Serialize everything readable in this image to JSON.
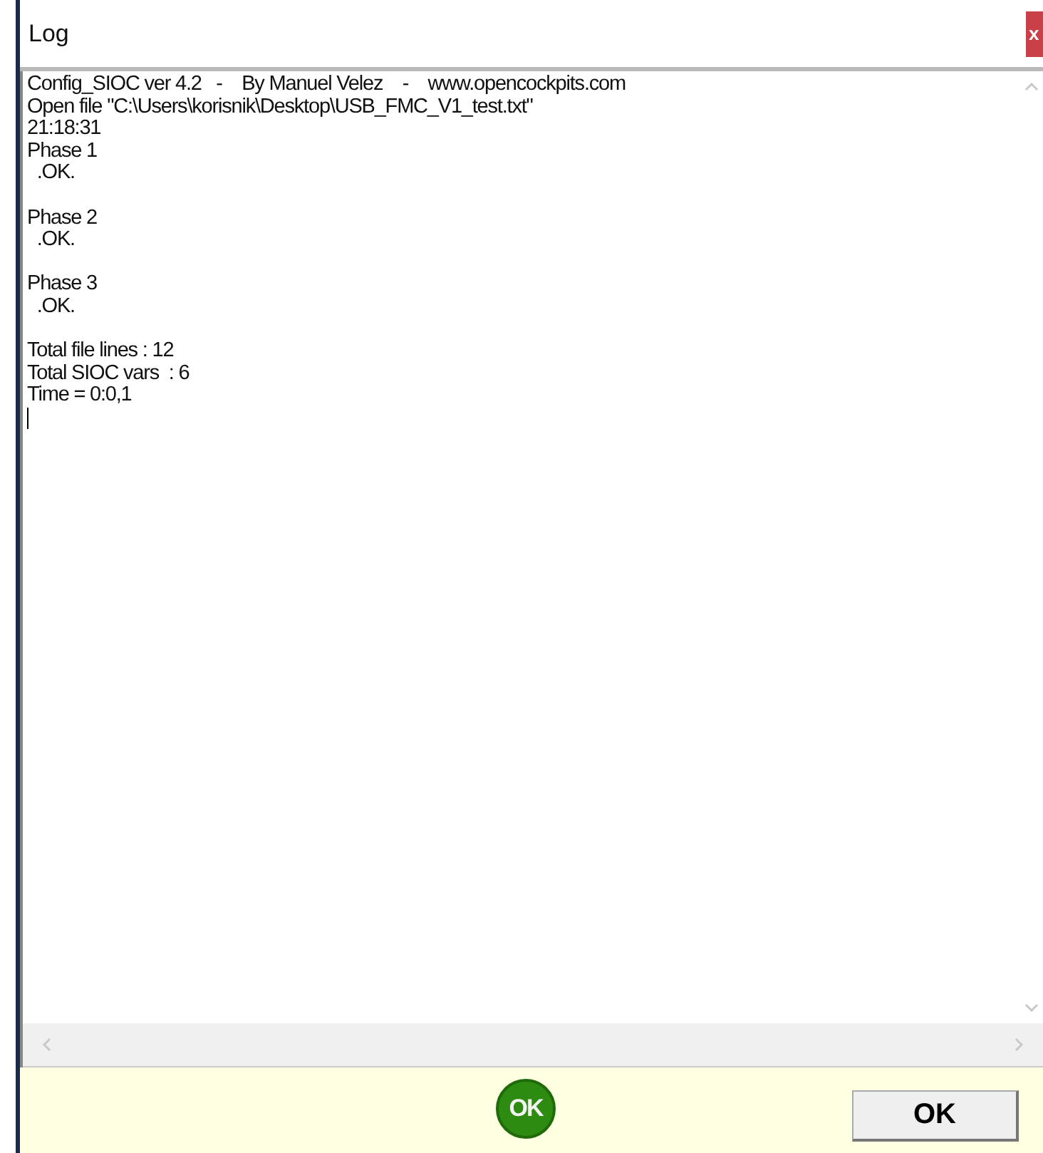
{
  "window": {
    "title": "Log",
    "close": "x"
  },
  "log": {
    "blocks": [
      [
        "Config_SIOC ver 4.2   -    By Manuel Velez    -    www.opencockpits.com",
        "Open file \"C:\\Users\\korisnik\\Desktop\\USB_FMC_V1_test.txt\"",
        "21:18:31",
        "Phase 1",
        "  .OK."
      ],
      [
        "Phase 2",
        "  .OK."
      ],
      [
        "Phase 3",
        "  .OK."
      ],
      [
        "Total file lines : 12",
        "Total SIOC vars  : 6",
        "Time = 0:0,1"
      ]
    ]
  },
  "footer": {
    "badge": "OK",
    "button": "OK"
  }
}
